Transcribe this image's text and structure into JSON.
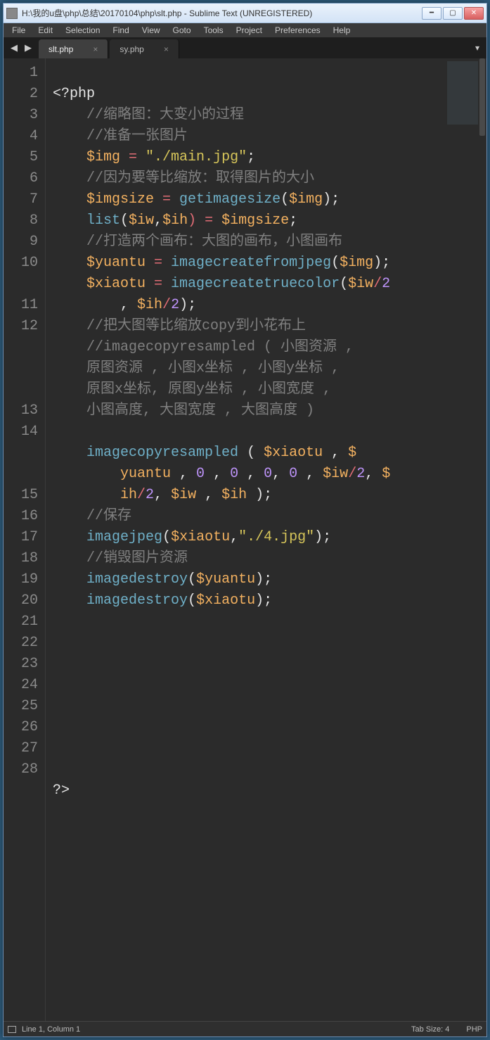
{
  "titlebar": {
    "text": "H:\\我的u盘\\php\\总结\\20170104\\php\\slt.php - Sublime Text (UNREGISTERED)"
  },
  "menu": {
    "items": [
      "File",
      "Edit",
      "Selection",
      "Find",
      "View",
      "Goto",
      "Tools",
      "Project",
      "Preferences",
      "Help"
    ]
  },
  "tabs": [
    {
      "label": "slt.php",
      "active": true
    },
    {
      "label": "sy.php",
      "active": false
    }
  ],
  "statusbar": {
    "linecol": "Line 1, Column 1",
    "tabsize": "Tab Size: 4",
    "syntax": "PHP"
  },
  "gutter": {
    "lines": [
      "1",
      "2",
      "3",
      "4",
      "5",
      "6",
      "7",
      "8",
      "9",
      "10",
      "11",
      "12",
      "13",
      "14",
      "15",
      "16",
      "17",
      "18",
      "19",
      "20",
      "21",
      "22",
      "23",
      "24",
      "25",
      "26",
      "27",
      "28"
    ]
  },
  "code": {
    "l1_open": "<?php",
    "l2_cmt": "//缩略图：大变小的过程",
    "l3_cmt": "//准备一张图片",
    "l4_var": "$img",
    "l4_eq": " = ",
    "l4_str": "\"./main.jpg\"",
    "l4_end": ";",
    "l5_cmt": "//因为要等比缩放：取得图片的大小",
    "l6_v1": "$imgsize",
    "l6_eq": " = ",
    "l6_fn": "getimagesize",
    "l6_op": "(",
    "l6_v2": "$img",
    "l6_end": ");",
    "l7_fn": "list",
    "l7_op": "(",
    "l7_v1": "$iw",
    "l7_comma": ",",
    "l7_v2": "$ih",
    "l7_cp": ") = ",
    "l7_v3": "$imgsize",
    "l7_end": ";",
    "l8_cmt": "//打造两个画布：大图的画布，小图画布",
    "l9_v1": "$yuantu",
    "l9_eq": " = ",
    "l9_fn": "imagecreatefromjpeg",
    "l9_op": "(",
    "l9_v2": "$img",
    "l9_end": ");",
    "l10_v1": "$xiaotu",
    "l10_eq": " = ",
    "l10_fn": "imagecreatetruecolor",
    "l10_op": "(",
    "l10_v2": "$iw",
    "l10_div": "/",
    "l10_n2": "2",
    "l10b_pre": "    , ",
    "l10b_v": "$ih",
    "l10b_div": "/",
    "l10b_n": "2",
    "l10b_end": ");",
    "l11_cmt": "//把大图等比缩放copy到小花布上",
    "l12_cmt1": "//imagecopyresampled ( 小图资源 ,",
    "l12_cmt2": "原图资源 , 小图x坐标 , 小图y坐标 ,",
    "l12_cmt3": "原图x坐标, 原图y坐标 , 小图宽度 ,",
    "l12_cmt4": "小图高度, 大图宽度 , 大图高度 )",
    "l14_fn": "imagecopyresampled",
    "l14_sp": " ( ",
    "l14_v1": "$xiaotu",
    "l14_c1": " , ",
    "l14_v2p": "$",
    "l14w1_v": "yuantu",
    "l14w1_c": " , ",
    "l14w1_n0a": "0",
    "l14w1_c2": " , ",
    "l14w1_n0b": "0",
    "l14w1_c3": " , ",
    "l14w1_n0c": "0",
    "l14w1_c4": ", ",
    "l14w1_n0d": "0",
    "l14w1_c5": " , ",
    "l14w1_iw": "$iw",
    "l14w1_div": "/",
    "l14w1_two": "2",
    "l14w1_c6": ", ",
    "l14w1_d": "$",
    "l14w2_ih": "ih",
    "l14w2_div": "/",
    "l14w2_two": "2",
    "l14w2_c": ", ",
    "l14w2_iw": "$iw",
    "l14w2_c2": " , ",
    "l14w2_ihv": "$ih",
    "l14w2_end": " );",
    "l15_cmt": "//保存",
    "l16_fn": "imagejpeg",
    "l16_op": "(",
    "l16_v": "$xiaotu",
    "l16_c": ",",
    "l16_str": "\"./4.jpg\"",
    "l16_end": ");",
    "l17_cmt": "//销毁图片资源",
    "l18_fn": "imagedestroy",
    "l18_op": "(",
    "l18_v": "$yuantu",
    "l18_end": ");",
    "l19_fn": "imagedestroy",
    "l19_op": "(",
    "l19_v": "$xiaotu",
    "l19_end": ");",
    "l28_close": "?>"
  }
}
